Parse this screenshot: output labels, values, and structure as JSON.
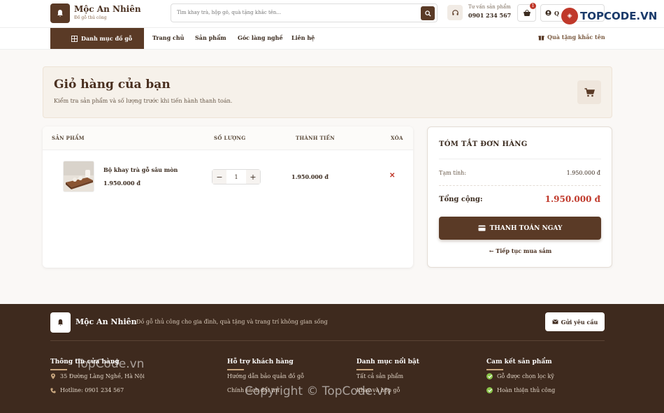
{
  "header": {
    "brand": "Mộc An Nhiên",
    "brand_sub": "Đồ gỗ thủ công",
    "search_placeholder": "Tìm khay trà, hộp gỗ, quà tặng khắc tên...",
    "consult_label": "Tư vấn sản phẩm",
    "consult_phone": "0901 234 567",
    "cart_count": "1",
    "account_label": "Q"
  },
  "nav": {
    "category": "Danh mục đồ gỗ",
    "links": [
      "Trang chủ",
      "Sản phẩm",
      "Góc làng nghề",
      "Liên hệ"
    ],
    "gift": "Quà tặng khắc tên"
  },
  "page": {
    "title": "Giỏ hàng của bạn",
    "subtitle": "Kiểm tra sản phẩm và số lượng trước khi tiến hành thanh toán."
  },
  "cart": {
    "columns": [
      "SẢN PHẨM",
      "SỐ LƯỢNG",
      "THÀNH TIỀN",
      "XÓA"
    ],
    "items": [
      {
        "name": "Bộ khay trà gỗ sâu mòn",
        "price": "1.950.000 đ",
        "qty": "1",
        "total": "1.950.000 đ"
      }
    ]
  },
  "summary": {
    "title": "TÓM TẮT ĐƠN HÀNG",
    "subtotal_label": "Tạm tính:",
    "subtotal_value": "1.950.000 đ",
    "total_label": "Tổng cộng:",
    "total_value": "1.950.000 đ",
    "checkout": "THANH TOÁN NGAY",
    "continue": "Tiếp tục mua sắm"
  },
  "footer": {
    "brand": "Mộc An Nhiên",
    "tagline": "Đồ gỗ thủ công cho gia đình, quà tặng và trang trí không gian sống",
    "request": "Gửi yêu cầu",
    "col1": {
      "title": "Thông tin cửa hàng",
      "items": [
        "35 Đường Làng Nghề, Hà Nội",
        "Hotline: 0901 234 567"
      ]
    },
    "col2": {
      "title": "Hỗ trợ khách hàng",
      "items": [
        "Hướng dẫn bảo quản đồ gỗ",
        "Chính sách đổi trả"
      ]
    },
    "col3": {
      "title": "Danh mục nổi bật",
      "items": [
        "Tất cả sản phẩm",
        "Khay và hộp gỗ"
      ]
    },
    "col4": {
      "title": "Cam kết sản phẩm",
      "items": [
        "Gỗ được chọn lọc kỹ",
        "Hoàn thiện thủ công"
      ]
    }
  },
  "watermarks": {
    "logo_text": "TOPCODE.VN",
    "text1": "TopCode.vn",
    "text2": "Copyright © TopCode.vn"
  }
}
